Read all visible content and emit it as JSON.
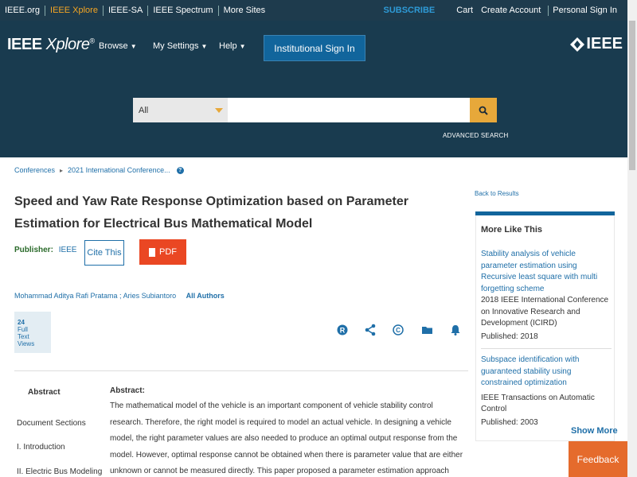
{
  "topbar": {
    "links": [
      "IEEE.org",
      "IEEE Xplore",
      "IEEE-SA",
      "IEEE Spectrum",
      "More Sites"
    ],
    "subscribe": "SUBSCRIBE",
    "cart": "Cart",
    "create_account": "Create Account",
    "personal_sign_in": "Personal Sign In"
  },
  "header": {
    "logo_prefix": "IEEE",
    "logo_suffix": "Xplore",
    "logo_mark": "®",
    "nav": [
      "Browse",
      "My Settings",
      "Help"
    ],
    "institutional_sign_in": "Institutional Sign In",
    "ieee_logo": "IEEE",
    "search": {
      "category": "All",
      "placeholder": "",
      "advanced": "ADVANCED SEARCH"
    }
  },
  "breadcrumb": [
    "Conferences",
    "2021 International Conference..."
  ],
  "back_to_results": "Back to Results",
  "article": {
    "title": "Speed and Yaw Rate Response Optimization based on Parameter Estimation for Electrical Bus Mathematical Model",
    "publisher_label": "Publisher:",
    "publisher_value": "IEEE",
    "cite_this": "Cite This",
    "pdf": "PDF",
    "authors": [
      "Mohammad Aditya Rafi Pratama ;",
      "Aries Subiantoro"
    ],
    "all_authors": "All Authors",
    "metric_value": "24",
    "metric_label_1": "Full",
    "metric_label_2": "Text Views"
  },
  "left_nav": {
    "abstract_tab": "Abstract",
    "document_sections": "Document Sections",
    "sections": [
      "I.   Introduction",
      "II.   Electric Bus Modeling"
    ]
  },
  "abstract": {
    "heading": "Abstract:",
    "text": "The mathematical model of the vehicle is an important component of vehicle stability control research. Therefore, the right model is required to model an actual vehicle. In designing a vehicle model, the right parameter values are also needed to produce an optimal output response from the model. However, optimal response cannot be obtained when there is parameter value that are either unknown or cannot be measured directly. This paper proposed a parameter estimation approach using the Quasi-Newton and least squares methods to estimate the value of the"
  },
  "more_like_this": {
    "title": "More Like This",
    "items": [
      {
        "link": "Stability analysis of vehicle parameter estimation using Recursive least square with multi forgetting scheme",
        "pub": "2018 IEEE International Conference on Innovative Research and Development (ICIRD)",
        "year": "Published: 2018"
      },
      {
        "link": "Subspace identification with guaranteed stability using constrained optimization",
        "pub": "IEEE Transactions on Automatic Control",
        "year": "Published: 2003"
      }
    ],
    "show_more": "Show More"
  },
  "feedback": "Feedback",
  "colors": {
    "header_bg": "#193b4f",
    "accent_orange": "#e7a83a",
    "pdf_red": "#ea4723",
    "link_blue": "#1f6fa8"
  }
}
